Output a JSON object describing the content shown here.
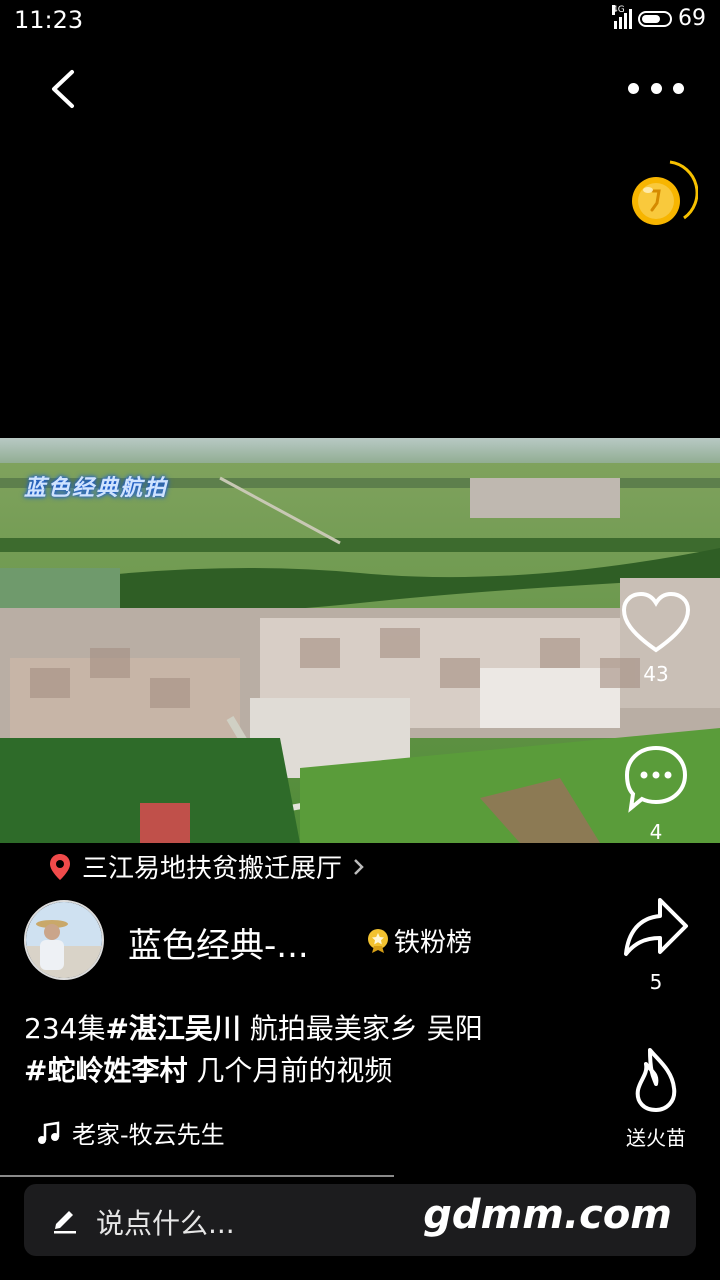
{
  "status_bar": {
    "time": "11:23",
    "network": "4G",
    "battery": "69"
  },
  "video": {
    "watermark": "蓝色经典航拍"
  },
  "actions": {
    "likes": "43",
    "comments": "4",
    "shares": "5",
    "seedling_label": "送火苗"
  },
  "location": {
    "name": "三江易地扶贫搬迁展厅"
  },
  "author": {
    "name": "蓝色经典-...",
    "fan_badge": "铁粉榜"
  },
  "description": {
    "prefix": "234集",
    "tag1": "#湛江吴川",
    "mid": "  航拍最美家乡  吴阳",
    "tag2": "#蛇岭姓李村",
    "suffix": " 几个月前的视频"
  },
  "music": {
    "title": "老家-牧云先生"
  },
  "comment_input": {
    "placeholder": "说点什么..."
  },
  "watermark_site": "gdmm.com",
  "colors": {
    "location_pin": "#f04a4a",
    "coin": "#f7b500",
    "badge": "#f2c230"
  }
}
